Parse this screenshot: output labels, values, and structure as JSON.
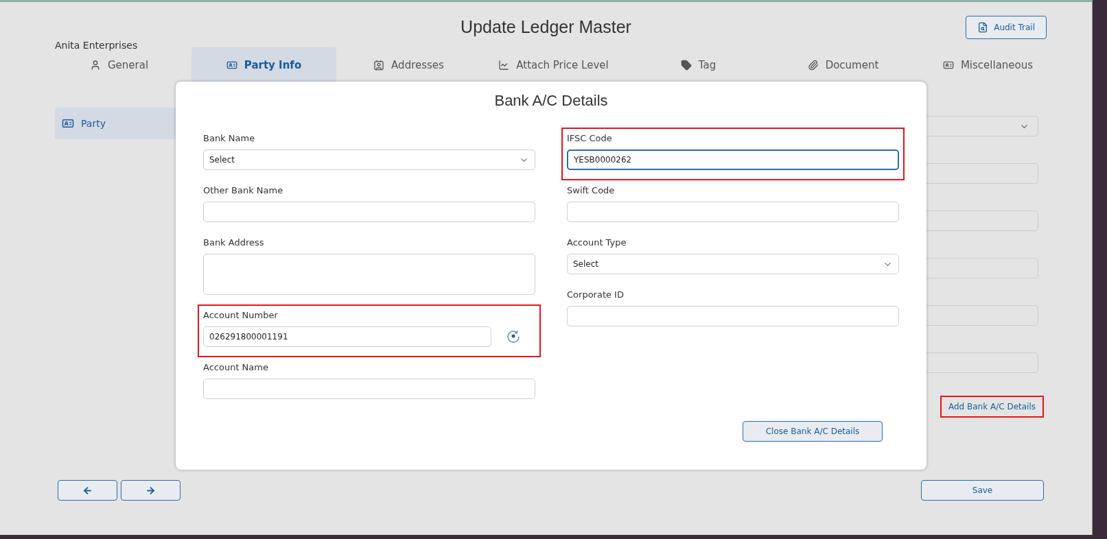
{
  "window": {
    "title": "Update Ledger Master"
  },
  "audit_button": {
    "label": "Audit Trail"
  },
  "company": "Anita Enterprises",
  "tabs": [
    {
      "label": "General",
      "selected": false
    },
    {
      "label": "Party Info",
      "selected": true
    },
    {
      "label": "Addresses",
      "selected": false
    },
    {
      "label": "Attach Price Level",
      "selected": false
    },
    {
      "label": "Tag",
      "selected": false
    },
    {
      "label": "Document",
      "selected": false
    },
    {
      "label": "Miscellaneous",
      "selected": false
    }
  ],
  "sidebar": {
    "items": [
      {
        "label": "Party",
        "selected": true
      }
    ]
  },
  "background_form": {
    "fields": [
      {
        "kind": "select"
      },
      {
        "kind": "text"
      },
      {
        "kind": "text"
      },
      {
        "kind": "text"
      },
      {
        "kind": "text"
      },
      {
        "kind": "text"
      }
    ],
    "add_link": {
      "label": "Add Bank A/C Details",
      "highlighted": true
    }
  },
  "dialog": {
    "title": "Bank A/C Details",
    "left": [
      {
        "label": "Bank Name",
        "kind": "select",
        "value": "Select",
        "highlighted": false
      },
      {
        "label": "Other Bank Name",
        "kind": "text",
        "highlighted": false
      },
      {
        "label": "Bank Address",
        "kind": "textarea",
        "highlighted": false
      },
      {
        "label": "Account Number",
        "kind": "verify",
        "value": "026291800001191",
        "highlighted": true
      },
      {
        "label": "Account Name",
        "kind": "text",
        "highlighted": false
      }
    ],
    "right": [
      {
        "label": "IFSC Code",
        "kind": "text",
        "value": "YESB0000262",
        "highlighted": true,
        "focused": true
      },
      {
        "label": "Swift Code",
        "kind": "text",
        "highlighted": false
      },
      {
        "label": "Account Type",
        "kind": "select",
        "value": "Select",
        "highlighted": false
      },
      {
        "label": "Corporate ID",
        "kind": "text",
        "highlighted": false
      }
    ],
    "close_button": {
      "label": "Close Bank A/C Details"
    }
  },
  "save_button": {
    "label": "Save"
  }
}
